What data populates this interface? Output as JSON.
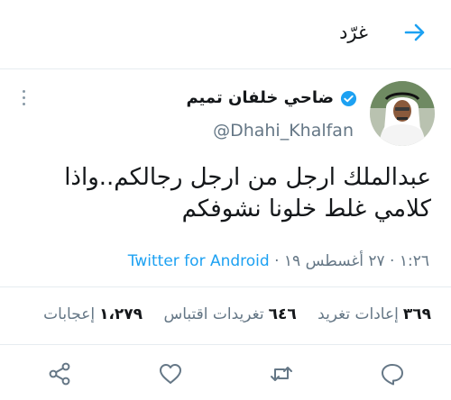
{
  "header": {
    "title": "غرّد",
    "back_icon": "arrow-right-icon"
  },
  "tweet": {
    "display_name": "ضاحي خلفان تميم",
    "handle": "@Dhahi_Khalfan",
    "verified_icon": "verified-badge-icon",
    "text": "عبدالملك ارجل من ارجل رجالكم..واذا كلامي غلط خلونا نشوفكم",
    "timestamp": "١:٢٦ · ٢٧ أغسطس ١٩ ·",
    "client": "Twitter for Android"
  },
  "stats": {
    "retweets_count": "٣٦٩",
    "retweets_label": "إعادات تغريد",
    "quotes_count": "٦٤٦",
    "quotes_label": "تغريدات اقتباس",
    "likes_count": "١،٢٧٩",
    "likes_label": "إعجابات"
  },
  "actions": [
    "reply-icon",
    "retweet-icon",
    "like-icon",
    "share-icon"
  ],
  "colors": {
    "accent": "#1da1f2",
    "text": "#14171a",
    "secondary": "#657786",
    "border": "#e6ecf0"
  }
}
